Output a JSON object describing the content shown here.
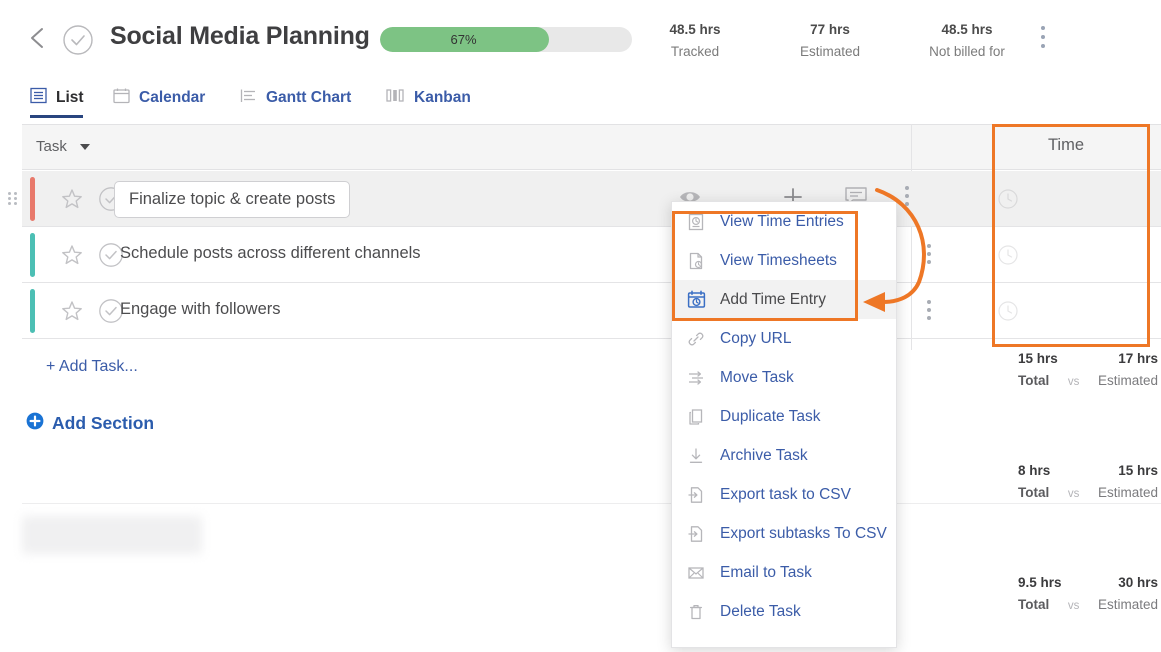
{
  "header": {
    "back_icon": "chevron-left-icon",
    "complete_icon": "check-circle-icon",
    "title": "Social Media Planning",
    "progress": {
      "percent": 67,
      "label": "67%",
      "fill_color": "#7dc384",
      "track_color": "#e8e8e8"
    },
    "stats": [
      {
        "value": "48.5 hrs",
        "label": "Tracked"
      },
      {
        "value": "77 hrs",
        "label": "Estimated"
      },
      {
        "value": "48.5 hrs",
        "label": "Not billed for"
      }
    ],
    "overflow_icon": "more-vertical-icon"
  },
  "tabs": [
    {
      "label": "List",
      "icon": "list-icon",
      "active": true
    },
    {
      "label": "Calendar",
      "icon": "calendar-icon",
      "active": false
    },
    {
      "label": "Gantt Chart",
      "icon": "gantt-icon",
      "active": false
    },
    {
      "label": "Kanban",
      "icon": "kanban-icon",
      "active": false
    }
  ],
  "table": {
    "columns": {
      "task": "Task",
      "time": "Time"
    },
    "sort_caret_icon": "caret-down-icon",
    "rows": [
      {
        "name": "Finalize topic & create posts",
        "accent_color": "#e8796b",
        "selected": true,
        "editing": true,
        "time": {
          "total": "15 hrs",
          "estimated": "17 hrs",
          "total_label": "Total",
          "vs": "vs",
          "estimated_label": "Estimated"
        }
      },
      {
        "name": "Schedule posts across different channels",
        "accent_color": "#4cbfb4",
        "selected": false,
        "editing": false,
        "time": {
          "total": "8 hrs",
          "estimated": "15 hrs",
          "total_label": "Total",
          "vs": "vs",
          "estimated_label": "Estimated"
        }
      },
      {
        "name": "Engage with followers",
        "accent_color": "#4cbfb4",
        "selected": false,
        "editing": false,
        "time": {
          "total": "9.5 hrs",
          "estimated": "30 hrs",
          "total_label": "Total",
          "vs": "vs",
          "estimated_label": "Estimated"
        }
      }
    ]
  },
  "row_toolbar": [
    {
      "icon": "eye-icon"
    },
    {
      "icon": "plus-icon"
    },
    {
      "icon": "comment-icon"
    },
    {
      "icon": "more-vertical-icon"
    }
  ],
  "footer": {
    "add_task": "+ Add Task...",
    "add_section": "Add Section",
    "add_section_icon": "plus-circle-icon"
  },
  "context_menu": {
    "items": [
      {
        "label": "View Time Entries",
        "icon": "time-entries-icon",
        "highlighted": false
      },
      {
        "label": "View Timesheets",
        "icon": "timesheet-icon",
        "highlighted": false
      },
      {
        "label": "Add Time Entry",
        "icon": "add-time-entry-icon",
        "highlighted": true
      },
      {
        "label": "Copy URL",
        "icon": "link-icon",
        "highlighted": false
      },
      {
        "label": "Move Task",
        "icon": "move-icon",
        "highlighted": false
      },
      {
        "label": "Duplicate Task",
        "icon": "copy-icon",
        "highlighted": false
      },
      {
        "label": "Archive Task",
        "icon": "archive-icon",
        "highlighted": false
      },
      {
        "label": "Export task to CSV",
        "icon": "export-icon",
        "highlighted": false
      },
      {
        "label": "Export subtasks To CSV",
        "icon": "export-icon",
        "highlighted": false
      },
      {
        "label": "Email to Task",
        "icon": "mail-icon",
        "highlighted": false
      },
      {
        "label": "Delete Task",
        "icon": "trash-icon",
        "highlighted": false
      }
    ]
  },
  "annotations": {
    "color": "#ee7726",
    "highlight_boxes": [
      "context-menu-time-group",
      "time-column"
    ],
    "arrow": "curved-arrow-pointing-to-add-time-entry"
  }
}
